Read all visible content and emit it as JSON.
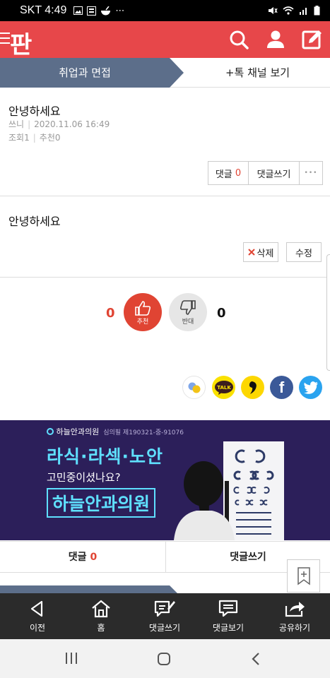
{
  "status_bar": {
    "carrier": "SKT",
    "time": "4:49",
    "more": "⋯"
  },
  "colors": {
    "brand": "#e7474a",
    "tab_active": "#5c6e8a",
    "recommend": "#e04433",
    "banner_bg": "#2c1f5a",
    "banner_accent": "#5fe0ff",
    "bottom_nav": "#2b2b2b"
  },
  "header": {
    "logo": "판",
    "icons": [
      "menu-icon",
      "search-icon",
      "user-icon",
      "edit-icon"
    ]
  },
  "tabs": [
    {
      "label": "취업과 면접",
      "active": true
    },
    {
      "label": "+톡 채널 보기",
      "active": false
    }
  ],
  "post": {
    "title": "안녕하세요",
    "author": "쓰니",
    "datetime": "2020.11.06 16:49",
    "views_label": "조회",
    "views": "1",
    "recommend_label": "추천",
    "recommend": "0",
    "body": "안녕하세요"
  },
  "actions": {
    "comment_label": "댓글",
    "comment_count": "0",
    "write_comment": "댓글쓰기",
    "more": "•••",
    "delete": "삭제",
    "edit": "수정"
  },
  "vote": {
    "up_count": "0",
    "up_label": "추천",
    "down_label": "반대",
    "down_count": "0"
  },
  "share": [
    "kakaostory-icon",
    "kakaotalk-icon",
    "band-icon",
    "facebook-icon",
    "twitter-icon"
  ],
  "share_labels": {
    "talk": "TALK",
    "facebook": "f"
  },
  "ad": {
    "brand": "하늘안과의원",
    "registration": "심의필 제190321-중-91076",
    "line1": "라식·라섹·노안",
    "line2": "고민중이셨나요?",
    "highlight": "하늘안과의원"
  },
  "comment_bar": {
    "comment_label": "댓글",
    "comment_count": "0",
    "write_comment": "댓글쓰기"
  },
  "bottom_nav": [
    {
      "label": "이전",
      "icon": "back-icon"
    },
    {
      "label": "홈",
      "icon": "home-icon"
    },
    {
      "label": "댓글쓰기",
      "icon": "write-comment-icon"
    },
    {
      "label": "댓글보기",
      "icon": "view-comments-icon"
    },
    {
      "label": "공유하기",
      "icon": "share-icon"
    }
  ],
  "system_nav": [
    "recent-apps-icon",
    "home-button-icon",
    "system-back-icon"
  ]
}
